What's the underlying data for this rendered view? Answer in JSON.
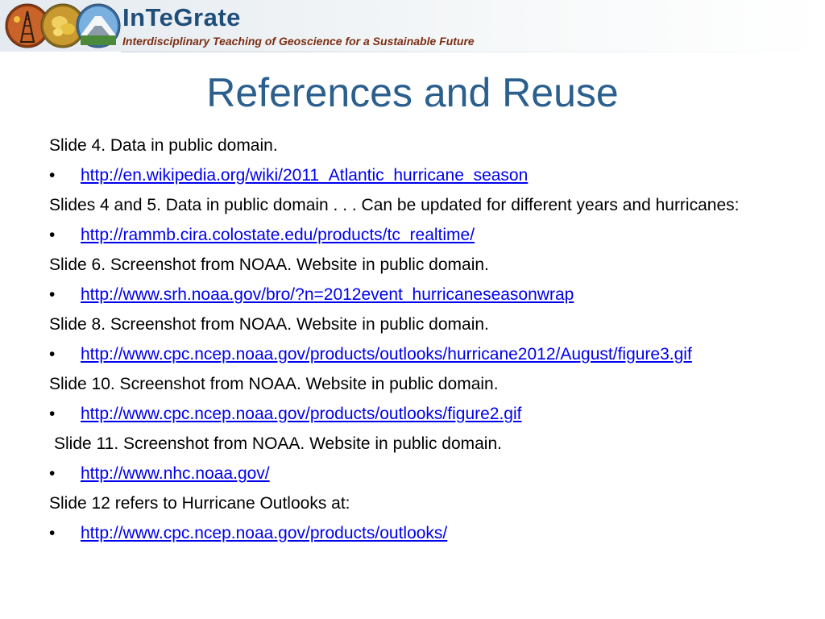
{
  "header": {
    "brand_title": "InTeGrate",
    "brand_tagline": "Interdisciplinary Teaching of Geoscience for a Sustainable Future",
    "logos": [
      "oil-derrick-icon",
      "gold-nugget-icon",
      "volcano-icon"
    ]
  },
  "slide": {
    "title": "References and Reuse",
    "bullet_char": "•",
    "items": [
      {
        "type": "para",
        "text": "Slide 4. Data in public domain."
      },
      {
        "type": "link",
        "text": "http://en.wikipedia.org/wiki/2011_Atlantic_hurricane_season"
      },
      {
        "type": "para",
        "text": "Slides 4 and 5. Data in public domain . . . Can be updated for different years and hurricanes:"
      },
      {
        "type": "link",
        "text": "http://rammb.cira.colostate.edu/products/tc_realtime/"
      },
      {
        "type": "para",
        "text": "Slide 6. Screenshot from NOAA. Website in public domain."
      },
      {
        "type": "link",
        "text": "http://www.srh.noaa.gov/bro/?n=2012event_hurricaneseasonwrap"
      },
      {
        "type": "para",
        "text": "Slide 8. Screenshot from NOAA. Website in public domain."
      },
      {
        "type": "link",
        "text": "http://www.cpc.ncep.noaa.gov/products/outlooks/hurricane2012/August/figure3.gif"
      },
      {
        "type": "para",
        "text": "Slide 10. Screenshot from NOAA. Website in public domain."
      },
      {
        "type": "link",
        "text": "http://www.cpc.ncep.noaa.gov/products/outlooks/figure2.gif"
      },
      {
        "type": "para",
        "text": "Slide 11. Screenshot from NOAA. Website in public domain.",
        "indent": true
      },
      {
        "type": "link",
        "text": "http://www.nhc.noaa.gov/"
      },
      {
        "type": "para",
        "text": "Slide 12 refers to Hurricane Outlooks at:"
      },
      {
        "type": "link",
        "text": "http://www.cpc.ncep.noaa.gov/products/outlooks/"
      }
    ]
  },
  "colors": {
    "title": "#2b5f8e",
    "brand": "#1f4e79",
    "tagline": "#7b2e12",
    "link": "#0000ee"
  }
}
